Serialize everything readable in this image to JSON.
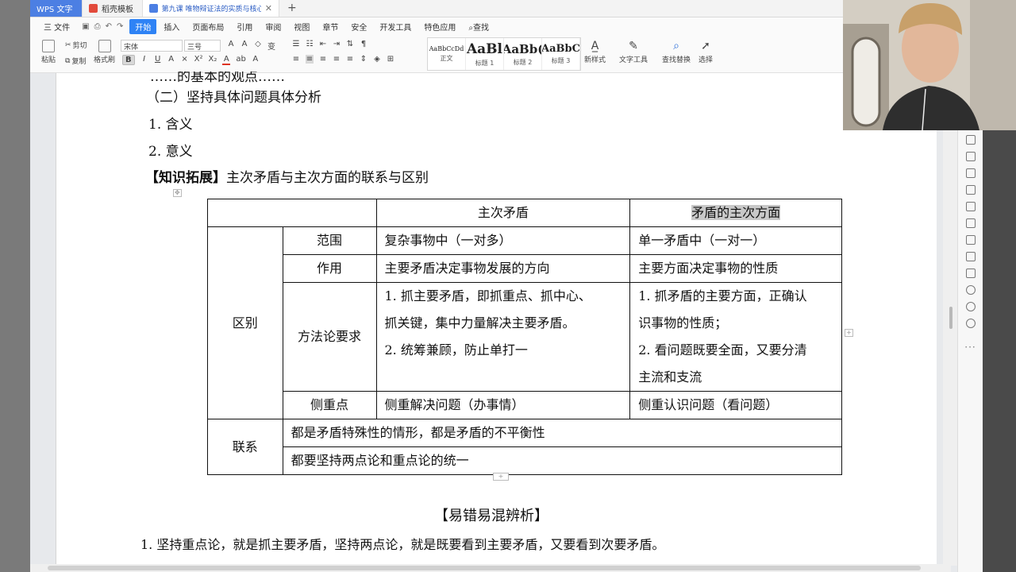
{
  "tabs": [
    {
      "label": "WPS 文字"
    },
    {
      "label": "稻壳模板"
    },
    {
      "label": "第九课 唯物辩证法的实质与核心"
    }
  ],
  "menu": {
    "file": "三 文件",
    "items": [
      "开始",
      "插入",
      "页面布局",
      "引用",
      "审阅",
      "视图",
      "章节",
      "安全",
      "开发工具",
      "特色应用"
    ],
    "search": "查找"
  },
  "ribbon": {
    "paste": "粘贴",
    "cut": "剪切",
    "format_painter": "格式刷",
    "copy": "复制",
    "font_name": "宋体",
    "font_size": "三号",
    "styles": [
      {
        "sample": "AaBbCcDd",
        "label": "正文"
      },
      {
        "sample": "AaBl",
        "label": "标题 1"
      },
      {
        "sample": "AaBb(",
        "label": "标题 2"
      },
      {
        "sample": "AaBbC",
        "label": "标题 3"
      }
    ],
    "new_style": "新样式",
    "text_tools": "文字工具",
    "find_replace": "查找替换",
    "select": "选择"
  },
  "document": {
    "heading_partial": "……的基本的观点……",
    "section": "（二）坚持具体问题具体分析",
    "item1": "1. 含义",
    "item2": "2. 意义",
    "ext_bracket": "【知识拓展】",
    "ext_title": "主次矛盾与主次方面的联系与区别",
    "table": {
      "h1": "主次矛盾",
      "h2": "矛盾的主次方面",
      "diff_label": "区别",
      "rows": [
        {
          "k": "范围",
          "a": "复杂事物中（一对多）",
          "b": "单一矛盾中（一对一）"
        },
        {
          "k": "作用",
          "a": "主要矛盾决定事物发展的方向",
          "b": "主要方面决定事物的性质"
        },
        {
          "k": "方法论要求",
          "a1": "1. 抓主要矛盾，即抓重点、抓中心、",
          "a2": "抓关键，集中力量解决主要矛盾。",
          "a3": "2. 统筹兼顾，防止单打一",
          "b1": "1. 抓矛盾的主要方面，正确认",
          "b2": "识事物的性质；",
          "b3": "2. 看问题既要全面，又要分清",
          "b4": "主流和支流"
        },
        {
          "k": "侧重点",
          "a": "侧重解决问题（办事情）",
          "b": "侧重认识问题（看问题）"
        }
      ],
      "link_label": "联系",
      "link1": "都是矛盾特殊性的情形，都是矛盾的不平衡性",
      "link2": "都要坚持两点论和重点论的统一"
    },
    "errors_title": "【易错易混辨析】",
    "errors_line1": "1. 坚持重点论，就是抓主要矛盾，坚持两点论，就是既要看到主要矛盾，又要看到次要矛盾。"
  },
  "colors": {
    "accent": "#2f83f5",
    "app_tab": "#4c7fe3",
    "highlight": "#c8c8c8"
  }
}
